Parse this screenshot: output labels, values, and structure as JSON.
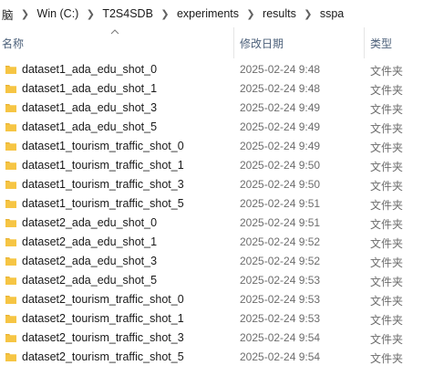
{
  "breadcrumb": [
    "脑",
    "Win (C:)",
    "T2S4SDB",
    "experiments",
    "results",
    "sspa"
  ],
  "columns": {
    "name": "名称",
    "date": "修改日期",
    "type": "类型"
  },
  "icons": {
    "separator": "chevron-right-icon",
    "folder": "folder-icon",
    "sort": "sort-ascending-icon"
  },
  "colors": {
    "folder": "#f6c544",
    "folder_tab": "#e8b233"
  },
  "files": [
    {
      "name": "dataset1_ada_edu_shot_0",
      "date": "2025-02-24 9:48",
      "type": "文件夹"
    },
    {
      "name": "dataset1_ada_edu_shot_1",
      "date": "2025-02-24 9:48",
      "type": "文件夹"
    },
    {
      "name": "dataset1_ada_edu_shot_3",
      "date": "2025-02-24 9:49",
      "type": "文件夹"
    },
    {
      "name": "dataset1_ada_edu_shot_5",
      "date": "2025-02-24 9:49",
      "type": "文件夹"
    },
    {
      "name": "dataset1_tourism_traffic_shot_0",
      "date": "2025-02-24 9:49",
      "type": "文件夹"
    },
    {
      "name": "dataset1_tourism_traffic_shot_1",
      "date": "2025-02-24 9:50",
      "type": "文件夹"
    },
    {
      "name": "dataset1_tourism_traffic_shot_3",
      "date": "2025-02-24 9:50",
      "type": "文件夹"
    },
    {
      "name": "dataset1_tourism_traffic_shot_5",
      "date": "2025-02-24 9:51",
      "type": "文件夹"
    },
    {
      "name": "dataset2_ada_edu_shot_0",
      "date": "2025-02-24 9:51",
      "type": "文件夹"
    },
    {
      "name": "dataset2_ada_edu_shot_1",
      "date": "2025-02-24 9:52",
      "type": "文件夹"
    },
    {
      "name": "dataset2_ada_edu_shot_3",
      "date": "2025-02-24 9:52",
      "type": "文件夹"
    },
    {
      "name": "dataset2_ada_edu_shot_5",
      "date": "2025-02-24 9:53",
      "type": "文件夹"
    },
    {
      "name": "dataset2_tourism_traffic_shot_0",
      "date": "2025-02-24 9:53",
      "type": "文件夹"
    },
    {
      "name": "dataset2_tourism_traffic_shot_1",
      "date": "2025-02-24 9:53",
      "type": "文件夹"
    },
    {
      "name": "dataset2_tourism_traffic_shot_3",
      "date": "2025-02-24 9:54",
      "type": "文件夹"
    },
    {
      "name": "dataset2_tourism_traffic_shot_5",
      "date": "2025-02-24 9:54",
      "type": "文件夹"
    }
  ]
}
